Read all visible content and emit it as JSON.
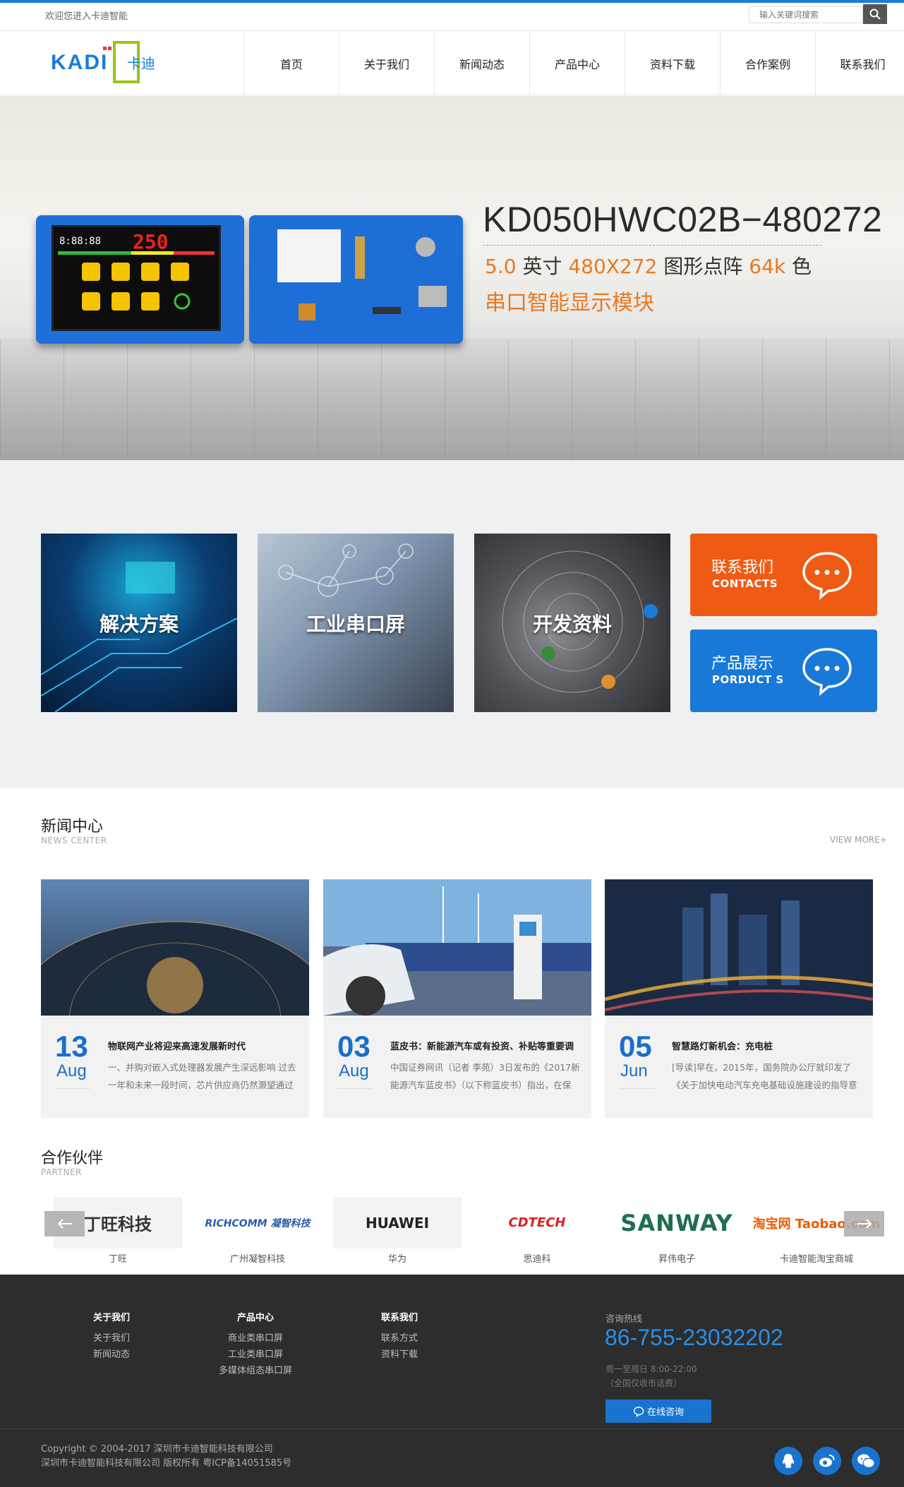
{
  "topbar": {
    "welcome": "欢迎您进入卡迪智能",
    "search_placeholder": "输入关键词搜索"
  },
  "brand": {
    "logo_text": "KADI",
    "logo_cn": "卡迪"
  },
  "nav": {
    "items": [
      "首页",
      "关于我们",
      "新闻动态",
      "产品中心",
      "资料下载",
      "合作案例",
      "联系我们"
    ]
  },
  "banner": {
    "title": "KD050HWC02B−480272",
    "size_num": "5.0",
    "size_unit": "英寸",
    "resolution": "480X272",
    "dot_matrix": "图形点阵",
    "colors_num": "64k",
    "colors_unit": "色",
    "subtitle": "串口智能显示模块"
  },
  "features": {
    "tiles": [
      "解决方案",
      "工业串口屏",
      "开发资料"
    ],
    "contact": {
      "title": "联系我们",
      "sub": "CONTACTS"
    },
    "product": {
      "title": "产品展示",
      "sub": "PORDUCT S"
    }
  },
  "news_section": {
    "title": "新闻中心",
    "subtitle": "NEWS CENTER",
    "view_more": "VIEW MORE+",
    "items": [
      {
        "day": "13",
        "month": "Aug",
        "title": "物联网产业将迎来高速发展新时代",
        "text": "一、并购对嵌入式处理器发展产生深远影响 过去一年和未来一段时间，芯片供应商仍然灏望通过"
      },
      {
        "day": "03",
        "month": "Aug",
        "title": "蓝皮书：新能源汽车或有投资、补贴等重要调",
        "text": "中国证券网讯（记者 李苑）3日发布的《2017新能源汽车蓝皮书》（以下称蓝皮书）指出，在保"
      },
      {
        "day": "05",
        "month": "Jun",
        "title": "智慧路灯新机会：充电桩",
        "text": "[导读]早在，2015年，国务院办公厅就印发了《关于加快电动汽车充电基础设施建设的指导意"
      }
    ]
  },
  "partners": {
    "title": "合作伙伴",
    "subtitle": "PARTNER",
    "items": [
      {
        "name": "丁旺",
        "logo": "丁旺科技"
      },
      {
        "name": "广州凝智科技",
        "logo": "RICHCOMM 凝智科技"
      },
      {
        "name": "华为",
        "logo": "HUAWEI"
      },
      {
        "name": "思迪科",
        "logo": "CDTECH"
      },
      {
        "name": "昇伟电子",
        "logo": "SANWAY"
      },
      {
        "name": "卡迪智能淘宝商城",
        "logo": "淘宝网 Taobao.com"
      }
    ]
  },
  "footer": {
    "col1": {
      "title": "关于我们",
      "links": [
        "关于我们",
        "新闻动态"
      ]
    },
    "col2": {
      "title": "产品中心",
      "links": [
        "商业类串口屏",
        "工业类串口屏",
        "多媒体组态串口屏"
      ]
    },
    "col3": {
      "title": "联系我们",
      "links": [
        "联系方式",
        "资料下载"
      ]
    },
    "hotline_label": "咨询热线",
    "hotline": "86-755-23032202",
    "hours": "周一至周日 8:00-22:00",
    "hours_note": "（全国仅收市话费）",
    "consult_button": "在线咨询",
    "copyright1": "Copyright © 2004-2017 深圳市卡迪智能科技有限公司",
    "copyright2": "深圳市卡迪智能科技有限公司 版权所有 粤ICP备14051585号"
  },
  "colors": {
    "brand_blue": "#1a7cd9",
    "accent_orange": "#ef5b14",
    "banner_orange": "#e8791f"
  }
}
